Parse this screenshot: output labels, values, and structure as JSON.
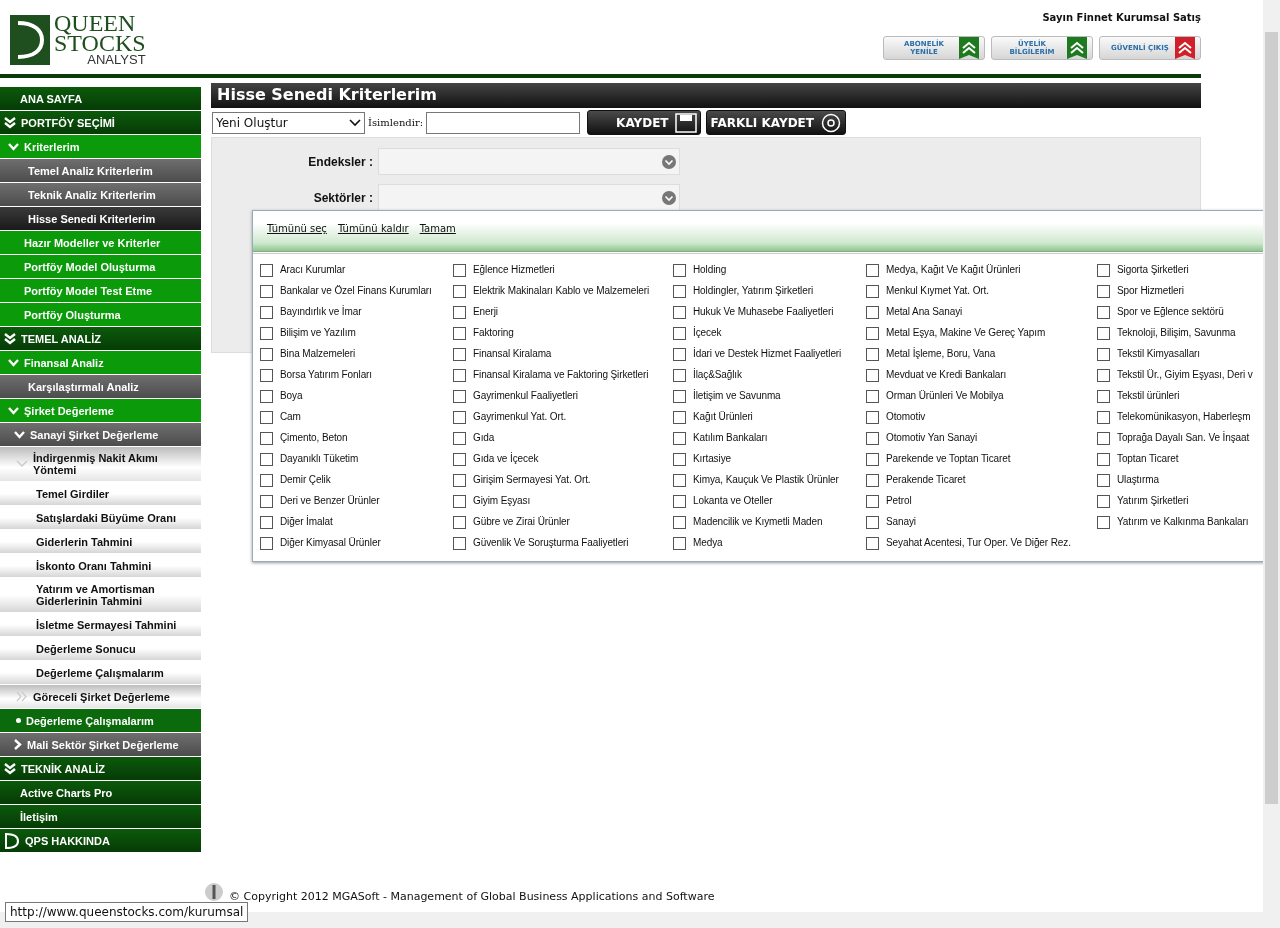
{
  "header": {
    "logo": {
      "line1": "QUEEN",
      "line2": "STOCKS",
      "line3": "ANALYST"
    },
    "greeting": "Sayın Finnet Kurumsal Satış",
    "buttons": [
      {
        "line1": "ABONELİK",
        "line2": "YENİLE",
        "color": "#1e7a1e"
      },
      {
        "line1": "ÜYELİK",
        "line2": "BİLGİLERİM",
        "color": "#1e7a1e"
      },
      {
        "line1": "GÜVENLİ ÇIKIŞ",
        "color": "#d0202a"
      }
    ]
  },
  "sidebar": {
    "items": [
      {
        "label": "ANA SAYFA",
        "kind": "main",
        "selected": false
      },
      {
        "label": "PORTFÖY SEÇİMİ",
        "kind": "section",
        "selected": false
      },
      {
        "label": "Kriterlerim",
        "kind": "group",
        "selected": false
      },
      {
        "label": "Temel Analiz Kriterlerim",
        "kind": "sub",
        "selected": false
      },
      {
        "label": "Teknik Analiz Kriterlerim",
        "kind": "sub",
        "selected": false
      },
      {
        "label": "Hisse Senedi Kriterlerim",
        "kind": "sub",
        "selected": true
      },
      {
        "label": "Hazır Modeller ve Kriterler",
        "kind": "link",
        "selected": false
      },
      {
        "label": "Portföy Model Oluşturma",
        "kind": "link",
        "selected": false
      },
      {
        "label": "Portföy Model Test Etme",
        "kind": "link",
        "selected": false
      },
      {
        "label": "Portföy Oluşturma",
        "kind": "link",
        "selected": false
      },
      {
        "label": "TEMEL ANALİZ",
        "kind": "section",
        "selected": false
      },
      {
        "label": "Finansal Analiz",
        "kind": "group",
        "selected": false
      },
      {
        "label": "Karşılaştırmalı Analiz",
        "kind": "sub",
        "selected": false
      },
      {
        "label": "Şirket Değerleme",
        "kind": "group",
        "selected": false
      },
      {
        "label": "Sanayi Şirket Değerleme",
        "kind": "subgroup",
        "selected": false
      },
      {
        "label": "İndirgenmiş Nakit Akımı Yöntemi",
        "kind": "method",
        "selected": false
      },
      {
        "label": "Temel Girdiler",
        "kind": "step",
        "selected": false
      },
      {
        "label": "Satışlardaki Büyüme Oranı",
        "kind": "step",
        "selected": false
      },
      {
        "label": "Giderlerin Tahmini",
        "kind": "step",
        "selected": false
      },
      {
        "label": "İskonto Oranı Tahmini",
        "kind": "step",
        "selected": false
      },
      {
        "label": "Yatırım ve Amortisman Giderlerinin Tahmini",
        "kind": "step",
        "selected": false
      },
      {
        "label": "İsletme Sermayesi Tahmini",
        "kind": "step",
        "selected": false
      },
      {
        "label": "Değerleme Sonucu",
        "kind": "step",
        "selected": false
      },
      {
        "label": "Değerleme Çalışmalarım",
        "kind": "step",
        "selected": false
      },
      {
        "label": "Göreceli Şirket Değerleme",
        "kind": "methodclosed",
        "selected": false
      },
      {
        "label": "Değerleme Çalışmalarım",
        "kind": "bullet",
        "selected": false
      },
      {
        "label": "Mali Sektör Şirket Değerleme",
        "kind": "collapsed",
        "selected": false
      },
      {
        "label": "TEKNİK ANALİZ",
        "kind": "section",
        "selected": false
      },
      {
        "label": "Active Charts Pro",
        "kind": "main",
        "selected": false
      },
      {
        "label": "İletişim",
        "kind": "main",
        "selected": false
      },
      {
        "label": "QPS HAKKINDA",
        "kind": "about",
        "selected": false
      }
    ]
  },
  "panel": {
    "title": "Hisse Senedi Kriterlerim",
    "select": "Yeni Oluştur",
    "name_label": "İsimlendir:",
    "save": "KAYDET",
    "save_as": "FARKLI KAYDET",
    "filters": [
      {
        "label": "Endeksler :"
      },
      {
        "label": "Sektörler :"
      }
    ]
  },
  "sector_dropdown": {
    "actions": [
      "Tümünü seç",
      "Tümünü kaldır",
      "Tamam"
    ],
    "columns": [
      {
        "options": [
          {
            "label": "Aracı Kurumlar",
            "checked": false
          },
          {
            "label": "Bankalar ve Özel Finans Kurumları",
            "checked": false
          },
          {
            "label": "Bayındırlık ve İmar",
            "checked": false
          },
          {
            "label": "Bilişim ve Yazılım",
            "checked": false
          },
          {
            "label": "Bina Malzemeleri",
            "checked": false
          },
          {
            "label": "Borsa Yatırım Fonları",
            "checked": false
          },
          {
            "label": "Boya",
            "checked": false
          },
          {
            "label": "Cam",
            "checked": false
          },
          {
            "label": "Çimento, Beton",
            "checked": false
          },
          {
            "label": "Dayanıklı Tüketim",
            "checked": false
          },
          {
            "label": "Demir Çelik",
            "checked": false
          },
          {
            "label": "Deri ve Benzer Ürünler",
            "checked": false
          },
          {
            "label": "Diğer İmalat",
            "checked": false
          },
          {
            "label": "Diğer Kimyasal Ürünler",
            "checked": false
          }
        ]
      },
      {
        "options": [
          {
            "label": "Eğlence Hizmetleri",
            "checked": false
          },
          {
            "label": "Elektrik Makinaları Kablo ve Malzemeleri",
            "checked": false
          },
          {
            "label": "Enerji",
            "checked": false
          },
          {
            "label": "Faktoring",
            "checked": false
          },
          {
            "label": "Finansal Kiralama",
            "checked": false
          },
          {
            "label": "Finansal Kiralama ve Faktoring Şirketleri",
            "checked": false
          },
          {
            "label": "Gayrimenkul Faaliyetleri",
            "checked": false
          },
          {
            "label": "Gayrimenkul Yat. Ort.",
            "checked": false
          },
          {
            "label": "Gıda",
            "checked": false
          },
          {
            "label": "Gıda ve İçecek",
            "checked": false
          },
          {
            "label": "Girişim Sermayesi Yat. Ort.",
            "checked": false
          },
          {
            "label": "Giyim Eşyası",
            "checked": false
          },
          {
            "label": "Gübre ve Zirai Ürünler",
            "checked": false
          },
          {
            "label": "Güvenlik Ve Soruşturma Faaliyetleri",
            "checked": false
          }
        ]
      },
      {
        "options": [
          {
            "label": "Holding",
            "checked": false
          },
          {
            "label": "Holdingler, Yatırım Şirketleri",
            "checked": false
          },
          {
            "label": "Hukuk Ve Muhasebe Faaliyetleri",
            "checked": false
          },
          {
            "label": "İçecek",
            "checked": false
          },
          {
            "label": "İdari ve Destek Hizmet Faaliyetleri",
            "checked": false
          },
          {
            "label": "İlaç&Sağlık",
            "checked": false
          },
          {
            "label": "İletişim ve Savunma",
            "checked": false
          },
          {
            "label": "Kağıt Ürünleri",
            "checked": false
          },
          {
            "label": "Katılım Bankaları",
            "checked": false
          },
          {
            "label": "Kırtasiye",
            "checked": false
          },
          {
            "label": "Kimya, Kauçuk Ve Plastik Ürünler",
            "checked": false
          },
          {
            "label": "Lokanta ve Oteller",
            "checked": false
          },
          {
            "label": "Madencilik ve Kıymetli Maden",
            "checked": false
          },
          {
            "label": "Medya",
            "checked": false
          }
        ]
      },
      {
        "options": [
          {
            "label": "Medya, Kağıt Ve Kağıt Ürünleri",
            "checked": false
          },
          {
            "label": "Menkul Kıymet Yat. Ort.",
            "checked": false
          },
          {
            "label": "Metal Ana Sanayi",
            "checked": false
          },
          {
            "label": "Metal Eşya, Makine Ve Gereç Yapım",
            "checked": false
          },
          {
            "label": "Metal İşleme, Boru, Vana",
            "checked": false
          },
          {
            "label": "Mevduat ve Kredi Bankaları",
            "checked": false
          },
          {
            "label": "Orman Ürünleri Ve Mobilya",
            "checked": false
          },
          {
            "label": "Otomotiv",
            "checked": false
          },
          {
            "label": "Otomotiv Yan Sanayi",
            "checked": false
          },
          {
            "label": "Parekende ve Toptan Ticaret",
            "checked": false
          },
          {
            "label": "Perakende Ticaret",
            "checked": false
          },
          {
            "label": "Petrol",
            "checked": false
          },
          {
            "label": "Sanayi",
            "checked": false
          },
          {
            "label": "Seyahat Acentesi, Tur Oper. Ve Diğer Rez.",
            "checked": false
          }
        ]
      },
      {
        "options": [
          {
            "label": "Sigorta Şirketleri",
            "checked": false
          },
          {
            "label": "Spor Hizmetleri",
            "checked": false
          },
          {
            "label": "Spor ve Eğlence sektörü",
            "checked": false
          },
          {
            "label": "Teknoloji, Bilişim, Savunma",
            "checked": false
          },
          {
            "label": "Tekstil Kimyasalları",
            "checked": false
          },
          {
            "label": "Tekstil Ür., Giyim Eşyası, Deri v",
            "checked": false
          },
          {
            "label": "Tekstil ürünleri",
            "checked": false
          },
          {
            "label": "Telekomünikasyon, Haberleşm",
            "checked": false
          },
          {
            "label": "Toprağa Dayalı San. Ve İnşaat",
            "checked": false
          },
          {
            "label": "Toptan Ticaret",
            "checked": false
          },
          {
            "label": "Ulaştırma",
            "checked": false
          },
          {
            "label": "Yatırım Şirketleri",
            "checked": false
          },
          {
            "label": "Yatırım ve Kalkınma Bankaları",
            "checked": false
          }
        ]
      }
    ]
  },
  "footer": {
    "copyright": "© Copyright 2012 MGASoft - Management of Global Business Applications and Software"
  },
  "status_url": "http://www.queenstocks.com/kurumsal"
}
